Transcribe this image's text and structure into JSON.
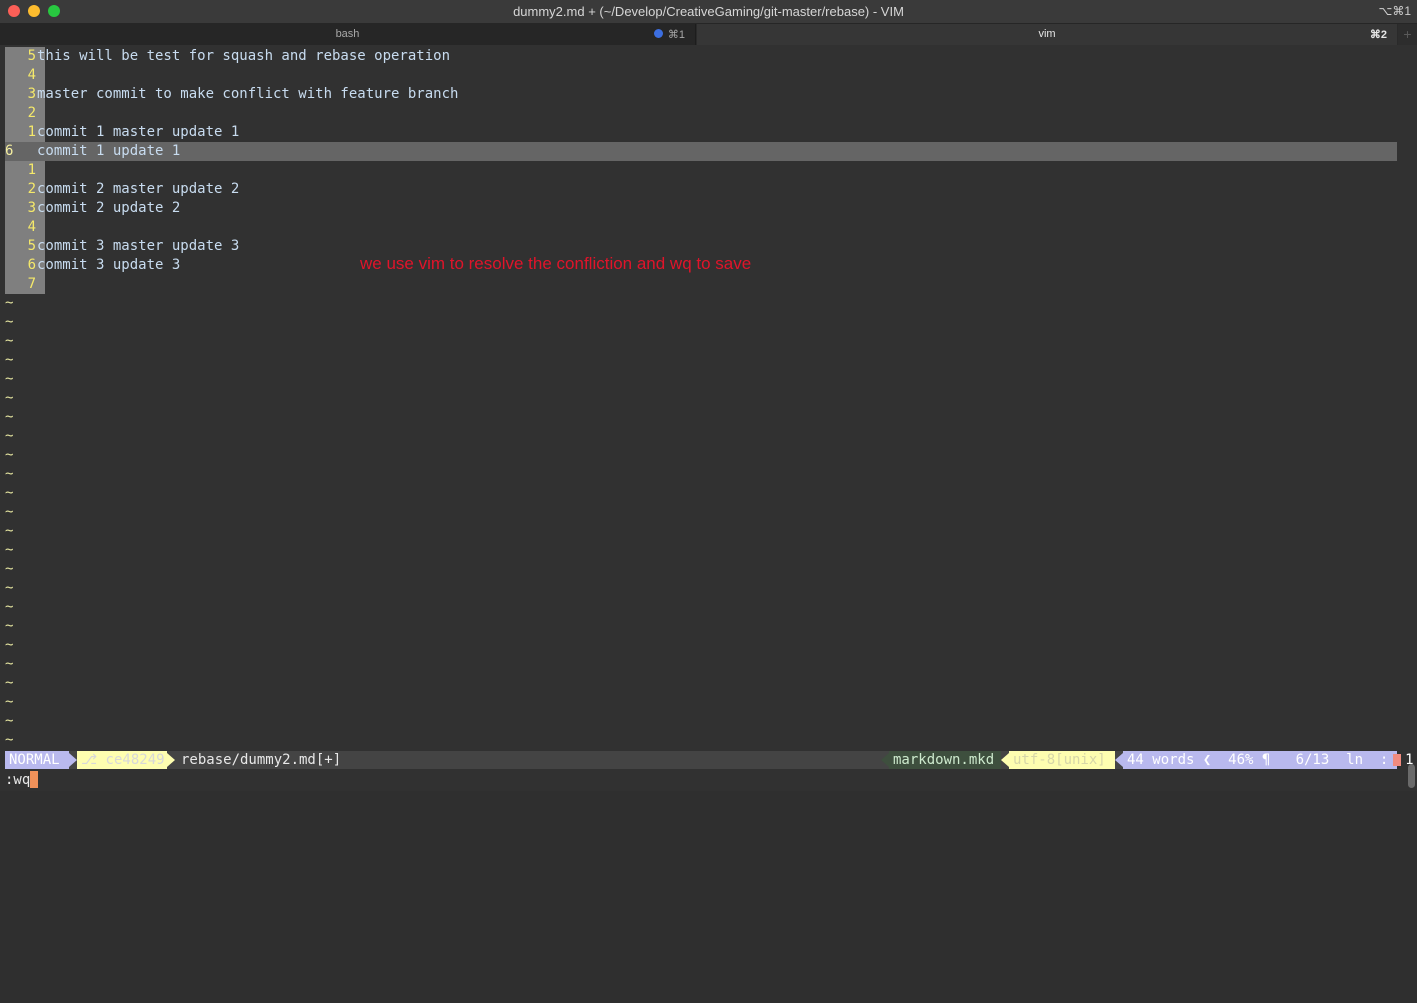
{
  "window": {
    "title": "dummy2.md + (~/Develop/CreativeGaming/git-master/rebase) - VIM",
    "title_shortcut": "⌥⌘1"
  },
  "tabs": [
    {
      "label": "bash",
      "shortcut": "⌘1",
      "active": false
    },
    {
      "label": "vim",
      "shortcut": "⌘2",
      "active": true
    }
  ],
  "tab_add": "+",
  "editor": {
    "lines": [
      {
        "num": "5",
        "text": "this will be test for squash and rebase operation"
      },
      {
        "num": "4",
        "text": ""
      },
      {
        "num": "3",
        "text": "master commit to make conflict with feature branch"
      },
      {
        "num": "2",
        "text": ""
      },
      {
        "num": "1",
        "text": "commit 1 master update 1"
      },
      {
        "num": "6",
        "text": "commit 1 update 1",
        "current": true
      },
      {
        "num": "1",
        "text": ""
      },
      {
        "num": "2",
        "text": "commit 2 master update 2"
      },
      {
        "num": "3",
        "text": "commit 2 update 2"
      },
      {
        "num": "4",
        "text": ""
      },
      {
        "num": "5",
        "text": "commit 3 master update 3"
      },
      {
        "num": "6",
        "text": "commit 3 update 3"
      },
      {
        "num": "7",
        "text": ""
      }
    ],
    "tilde": "~",
    "tilde_count": 24
  },
  "annotation": "we use vim to resolve the confliction and wq to save",
  "statusline": {
    "mode": "NORMAL",
    "branch": "⎇ ce48249",
    "file": "rebase/dummy2.md[+]",
    "filetype": "markdown.mkd",
    "encoding": "utf-8[unix]",
    "stats": "44 words ❮  46% ¶   6/13  ln  :  1"
  },
  "cmdline": ":wq",
  "colors": {
    "background": "#313131",
    "gutter": "#7f7f7f",
    "line_number": "#f5e96a",
    "text": "#c8dcf0",
    "annotation": "#e0142a",
    "mode_bg": "#b9b9ee",
    "branch_bg": "#fefeb0",
    "cursor": "#f0915a"
  }
}
